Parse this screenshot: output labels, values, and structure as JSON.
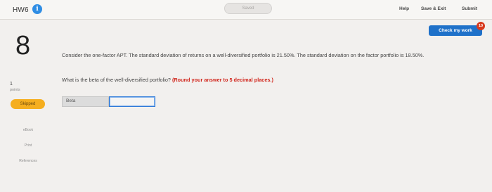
{
  "header": {
    "title": "HW6",
    "info_icon": "info-icon",
    "saved_label": "Saved",
    "help_label": "Help",
    "save_exit_label": "Save & Exit",
    "submit_label": "Submit"
  },
  "check_my_work": {
    "label": "Check my work",
    "badge": "10"
  },
  "question": {
    "number": "8",
    "points_value": "1",
    "points_label": "points",
    "status": "Skipped",
    "text": "Consider the one-factor APT. The standard deviation of returns on a well-diversified portfolio is 21.50%. The standard deviation on the factor portfolio is 18.50%.",
    "prompt": "What is the beta of the well-diversified portfolio?",
    "instruction": "(Round your answer to 5 decimal places.)"
  },
  "answer": {
    "label": "Beta",
    "value": "",
    "placeholder": ""
  },
  "resources": {
    "ebook": "eBook",
    "print": "Print",
    "references": "References"
  },
  "colors": {
    "primary": "#1f71c9",
    "badge": "#d8391d",
    "skipped": "#f5ae1f",
    "instruction": "#d1251b",
    "info_icon": "#2f8de4"
  }
}
